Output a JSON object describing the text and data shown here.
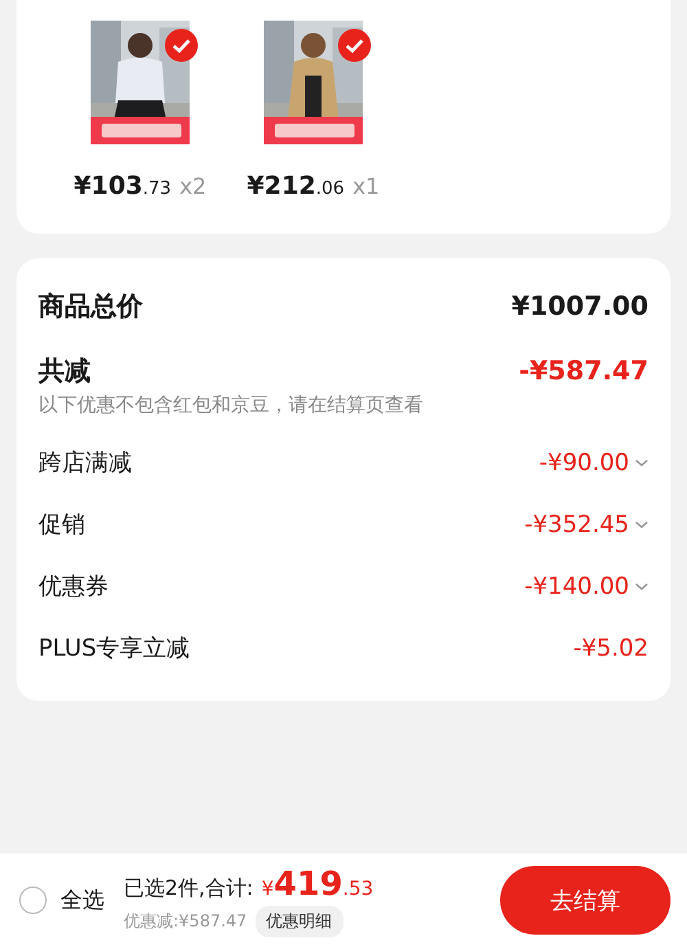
{
  "products": [
    {
      "kind": "picture",
      "selected": true,
      "price_main": "¥103",
      "price_cents": ".73",
      "quantity": "x2"
    },
    {
      "kind": "picture",
      "selected": true,
      "price_main": "¥212",
      "price_cents": ".06",
      "quantity": "x1"
    }
  ],
  "summary": {
    "total": {
      "label": "商品总价",
      "value": "¥1007.00"
    },
    "discount": {
      "label": "共减",
      "value": "-¥587.47",
      "note": "以下优惠不包含红包和京豆，请在结算页查看"
    },
    "items": [
      {
        "label": "跨店满减",
        "value": "-¥90.00",
        "expandable": true
      },
      {
        "label": "促销",
        "value": "-¥352.45",
        "expandable": true
      },
      {
        "label": "优惠券",
        "value": "-¥140.00",
        "expandable": true
      },
      {
        "label": "PLUS专享立减",
        "value": "-¥5.02",
        "expandable": false
      }
    ]
  },
  "footer": {
    "select_all": {
      "label": "全选",
      "checked": false
    },
    "summary_prefix": "已选2件,合计:",
    "currency": "¥",
    "amount_main": "419",
    "amount_cents": ".53",
    "saved": "优惠减:¥587.47",
    "details_button": "优惠明细",
    "checkout_button": "去结算"
  }
}
